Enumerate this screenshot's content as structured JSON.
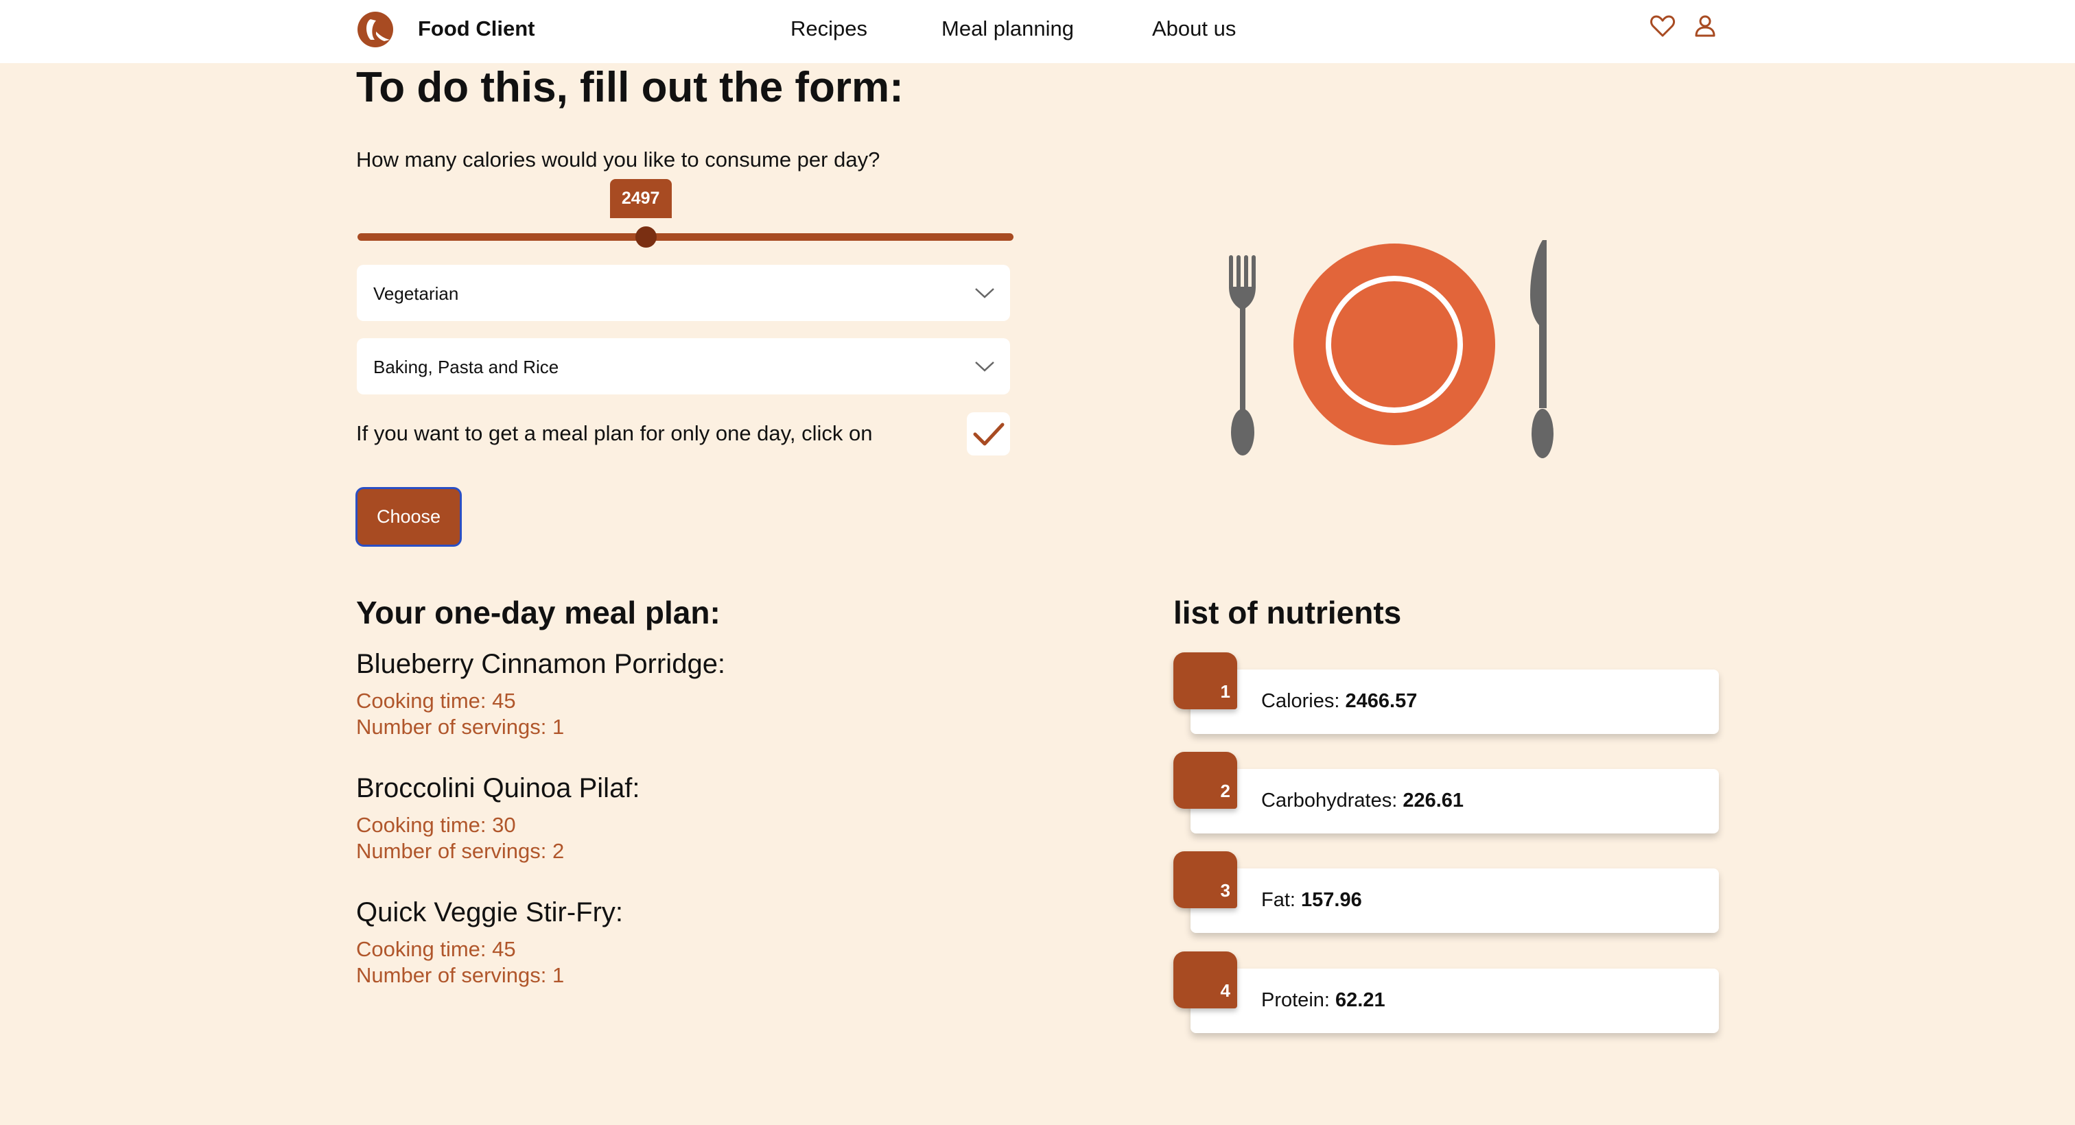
{
  "header": {
    "brand": "Food Client",
    "nav": [
      "Recipes",
      "Meal planning",
      "About us"
    ],
    "icons": [
      "heart-icon",
      "user-icon"
    ]
  },
  "form": {
    "title": "To do this, fill out the form:",
    "calorie_question": "How many calories would you like to consume per day?",
    "calories_value": "2497",
    "slider_fraction": 0.44,
    "diet_select": "Vegetarian",
    "category_select": "Baking, Pasta and Rice",
    "one_day_label": "If you want to get a meal plan for only one day, click on",
    "one_day_checked": true,
    "choose_button": "Choose"
  },
  "meal_plan": {
    "title": "Your one-day meal plan:",
    "meals": [
      {
        "name": "Blueberry Cinnamon Porridge:",
        "cooking_time": "Cooking time: 45",
        "servings": "Number of servings: 1"
      },
      {
        "name": "Broccolini Quinoa Pilaf:",
        "cooking_time": "Cooking time: 30",
        "servings": "Number of servings: 2"
      },
      {
        "name": "Quick Veggie Stir-Fry:",
        "cooking_time": "Cooking time: 45",
        "servings": "Number of servings: 1"
      }
    ]
  },
  "nutrients": {
    "title": "list of nutrients",
    "items": [
      {
        "num": "1",
        "label": "Calories: ",
        "value": "2466.57"
      },
      {
        "num": "2",
        "label": "Carbohydrates: ",
        "value": "226.61"
      },
      {
        "num": "3",
        "label": "Fat: ",
        "value": "157.96"
      },
      {
        "num": "4",
        "label": "Protein: ",
        "value": "62.21"
      }
    ]
  },
  "colors": {
    "accent": "#a84b22",
    "page_bg": "#fcf0e1",
    "plate": "#e2653a",
    "cutlery": "#666666",
    "meta_text": "#b0562b"
  }
}
